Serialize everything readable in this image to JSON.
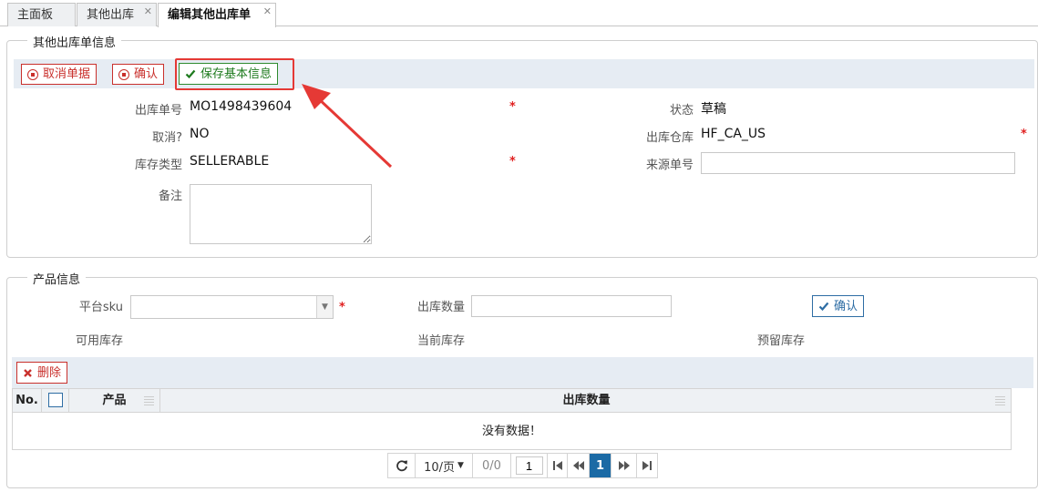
{
  "tabs": [
    {
      "label": "主面板",
      "closable": false,
      "active": false
    },
    {
      "label": "其他出库",
      "closable": true,
      "active": false
    },
    {
      "label": "编辑其他出库单",
      "closable": true,
      "active": true
    }
  ],
  "order_info": {
    "legend": "其他出库单信息",
    "toolbar": {
      "cancel_label": "取消单据",
      "confirm_label": "确认",
      "save_label": "保存基本信息"
    },
    "fields": {
      "order_no_label": "出库单号",
      "order_no_value": "MO1498439604",
      "status_label": "状态",
      "status_value": "草稿",
      "cancelled_label": "取消?",
      "cancelled_value": "NO",
      "warehouse_label": "出库仓库",
      "warehouse_value": "HF_CA_US",
      "stock_type_label": "库存类型",
      "stock_type_value": "SELLERABLE",
      "source_no_label": "来源单号",
      "source_no_value": "",
      "remark_label": "备注",
      "remark_value": ""
    },
    "required_mark": "*"
  },
  "product_info": {
    "legend": "产品信息",
    "platform_sku_label": "平台sku",
    "platform_sku_value": "",
    "qty_label": "出库数量",
    "qty_value": "",
    "confirm_label": "确认",
    "available_stock_label": "可用库存",
    "current_stock_label": "当前库存",
    "reserved_stock_label": "预留库存",
    "delete_label": "删除",
    "grid": {
      "col_no": "No.",
      "col_product": "产品",
      "col_qty": "出库数量",
      "empty_text": "没有数据！"
    },
    "pager": {
      "page_size": "10/页",
      "range": "0/0",
      "page_input": "1",
      "current_page": "1"
    }
  },
  "colors": {
    "accent_red": "#e53935",
    "danger": "#c9302c",
    "success": "#2e8a2e",
    "primary": "#1b6aa5"
  },
  "icons": [
    "refresh-icon",
    "chevron-down-icon",
    "first-page-icon",
    "prev-page-icon",
    "next-page-icon",
    "last-page-icon",
    "check-icon",
    "stop-icon",
    "delete-x-icon"
  ]
}
